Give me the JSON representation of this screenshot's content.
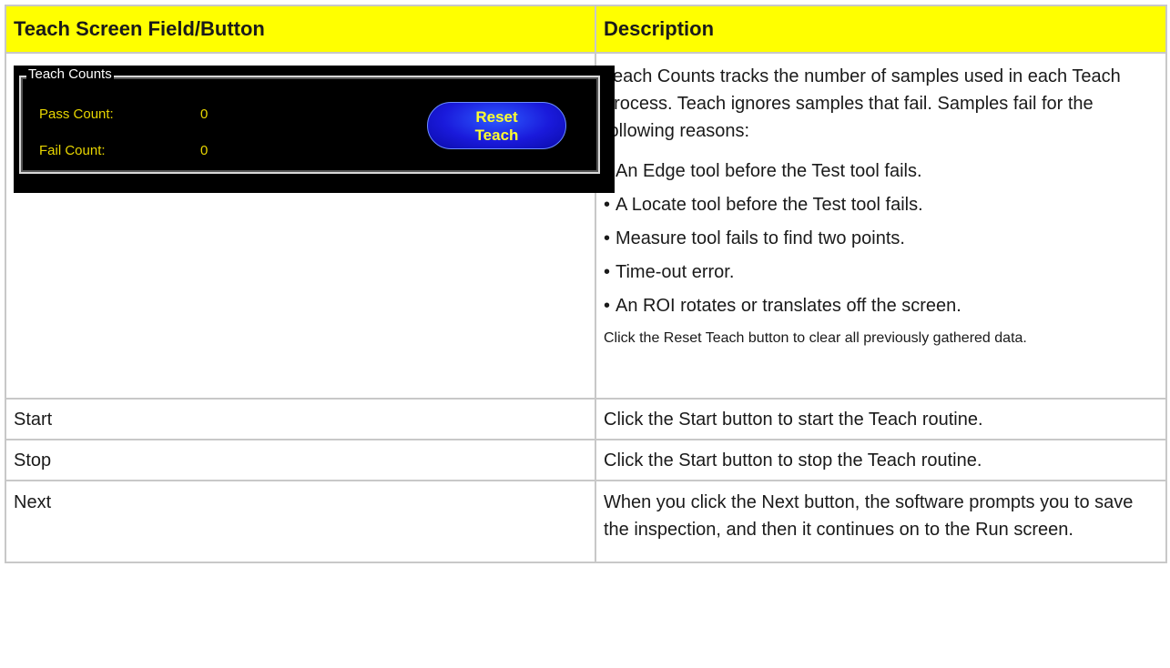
{
  "table": {
    "header": {
      "col1": "Teach Screen Field/Button",
      "col2": "Description"
    },
    "teach_counts_row": {
      "widget": {
        "group_title": "Teach Counts",
        "pass_label": "Pass Count:",
        "pass_value": "0",
        "fail_label": "Fail Count:",
        "fail_value": "0",
        "reset_button_line1": "Reset",
        "reset_button_line2": "Teach"
      },
      "intro": "Teach Counts tracks the number of samples used in each Teach process. Teach ignores samples that fail. Samples fail for the following reasons:",
      "bullets": [
        "An Edge tool before the Test tool fails.",
        "A Locate tool before the Test tool fails.",
        "Measure tool fails to find two points.",
        "Time-out error.",
        "An ROI rotates or translates off the screen."
      ],
      "note": "Click the Reset Teach button to clear all previously gathered data."
    },
    "rows": [
      {
        "field": "Start",
        "description": "Click the Start button to start the Teach routine."
      },
      {
        "field": "Stop",
        "description": "Click the Start button to stop the Teach routine."
      },
      {
        "field": "Next",
        "description": "When you click the Next button, the software prompts you to save the inspection, and then it continues on to the Run screen."
      }
    ]
  }
}
